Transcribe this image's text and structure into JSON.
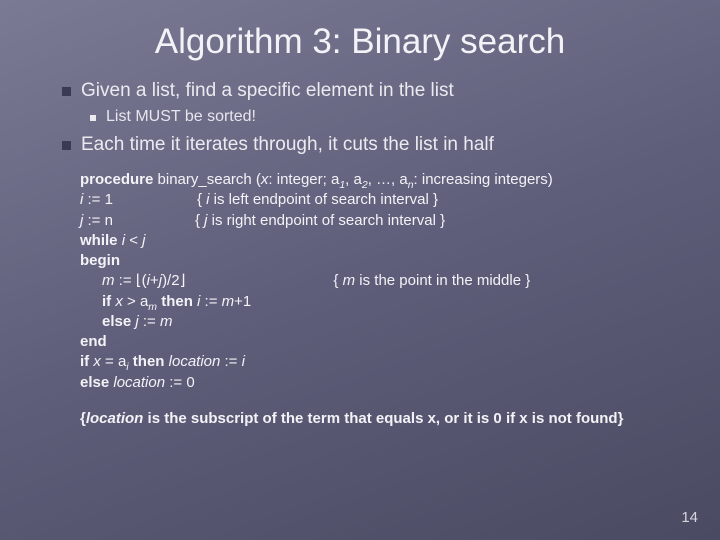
{
  "title": "Algorithm 3: Binary search",
  "bullets": {
    "b1": "Given a list, find a specific element in the list",
    "b1a": "List MUST be sorted!",
    "b2": "Each time it iterates through, it cuts the list in half"
  },
  "code_bold_procedure": "procedure",
  "code_procname": " binary_search (",
  "code_x": "x",
  "code_procdecl": ": integer; a",
  "code_sub1": "1",
  "code_comma": ", a",
  "code_sub2": "2",
  "code_dots": ", …, a",
  "code_subn": "n",
  "code_procend": ": increasing integers)",
  "code_i": "i",
  "code_asgn": " := 1",
  "code_ci": "{ ",
  "code_ci2": " is left endpoint of search interval }",
  "code_j": "j",
  "code_jasgn": " := n",
  "code_cj": "{ ",
  "code_cj2": " is right endpoint of search interval }",
  "code_while": "while ",
  "code_while_cond": " < ",
  "code_begin": "begin",
  "code_m": "m",
  "code_masgn": " := ⌊(",
  "code_masgn2": "+",
  "code_masgn3": ")/2⌋",
  "code_mcom": "{ ",
  "code_mcom2": " is the point in the middle }",
  "code_if": "if ",
  "code_xgt": " > a",
  "code_then": " then ",
  "code_ip1": " := ",
  "code_ip1b": "+1",
  "code_else": "else ",
  "code_jem": " := ",
  "code_end": "end",
  "code_if2": "if ",
  "code_eq": " = a",
  "code_then2": "then ",
  "code_loc": "location",
  "code_locasgn": " := ",
  "code_else2": "else ",
  "code_loc0": " := 0",
  "code_footnote": "{",
  "code_footnote_loc": "location",
  "code_footnote_rest": " is the subscript of the term that equals x, or it is 0 if x is not found}",
  "page_number": "14"
}
